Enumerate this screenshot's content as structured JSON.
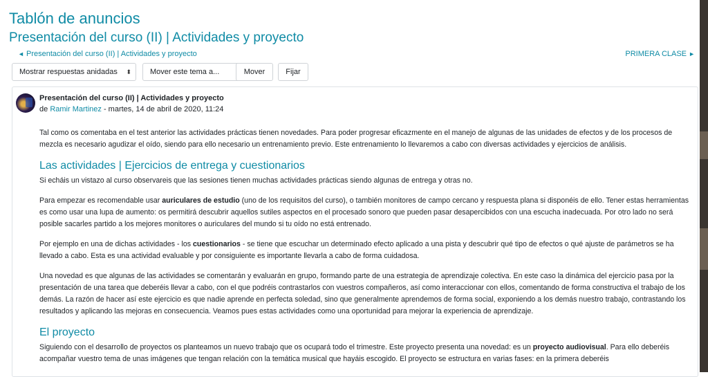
{
  "forum_title": "Tablón de anuncios",
  "discussion_title": "Presentación del curso (II) | Actividades y proyecto",
  "nav": {
    "prev_arrow": "◄",
    "prev_label": "Presentación del curso (II) | Actividades y proyecto",
    "next_label": "PRIMERA CLASE",
    "next_arrow": "►"
  },
  "controls": {
    "display_mode": "Mostrar respuestas anidadas",
    "move_topic": "Mover este tema a...",
    "move_button": "Mover",
    "pin_button": "Fijar",
    "caret": "⬍"
  },
  "post": {
    "subject": "Presentación del curso (II) | Actividades y proyecto",
    "by_prefix": "de",
    "author": "Ramir Martinez",
    "date": "- martes, 14 de abril de 2020, 11:24",
    "intro": "Tal como os comentaba en el test anterior las actividades prácticas tienen novedades. Para poder progresar eficazmente en el manejo de algunas de las unidades de efectos y de los procesos de mezcla es necesario agudizar el oído, siendo para ello necesario un entrenamiento previo. Este entrenamiento lo llevaremos a cabo con diversas actividades y ejercicios de análisis.",
    "heading1": "Las actividades | Ejercicios de entrega y cuestionarios",
    "p1": "Si echáis un vistazo al curso observareis que las sesiones tienen muchas actividades prácticas siendo algunas de entrega y otras no.",
    "p2_a": "Para empezar es recomendable usar ",
    "p2_b": "auriculares de estudio",
    "p2_c": " (uno de los requisitos del curso), o también monitores de campo cercano y respuesta plana si disponéis de ello. Tener estas herramientas es como usar una lupa de aumento: os permitirá descubrir aquellos sutiles aspectos en el procesado sonoro que pueden pasar desapercibidos con una escucha inadecuada. Por otro lado no será posible sacarles partido a los mejores monitores o auriculares del mundo si tu oído no está entrenado.",
    "p3_a": "Por ejemplo en una de dichas actividades - los ",
    "p3_b": "cuestionarios",
    "p3_c": " - se tiene que escuchar un determinado efecto aplicado a una pista y descubrir qué tipo de efectos o qué ajuste de parámetros se ha llevado a cabo. Esta es una actividad evaluable y por consiguiente es importante llevarla a cabo de forma cuidadosa.",
    "p4": "Una novedad es que algunas de las actividades se comentarán y evaluarán en grupo, formando parte de una estrategia de aprendizaje colectiva. En este caso la dinámica del ejercicio pasa por la presentación de una tarea que deberéis llevar a cabo,  con el que podréis contrastarlos con vuestros compañeros, así como interaccionar con ellos, comentando de forma constructiva el trabajo de los demás. La razón de hacer así este ejercicio es que nadie aprende en perfecta soledad, sino que generalmente aprendemos de forma social, exponiendo a los demás nuestro trabajo, contrastando los resultados y aplicando las mejoras en consecuencia. Veamos pues estas actividades como una oportunidad para mejorar la experiencia de aprendizaje.",
    "heading2": "El proyecto",
    "p5_a": "Siguiendo con el desarrollo de proyectos os planteamos un nuevo trabajo que os ocupará todo el trimestre. Este proyecto presenta una novedad: es un ",
    "p5_b": "proyecto audiovisual",
    "p5_c": ". Para ello deberéis acompañar vuestro tema de unas imágenes que tengan relación con la temática musical que hayáis escogido. El proyecto se estructura en varias fases: en la primera deberéis"
  }
}
